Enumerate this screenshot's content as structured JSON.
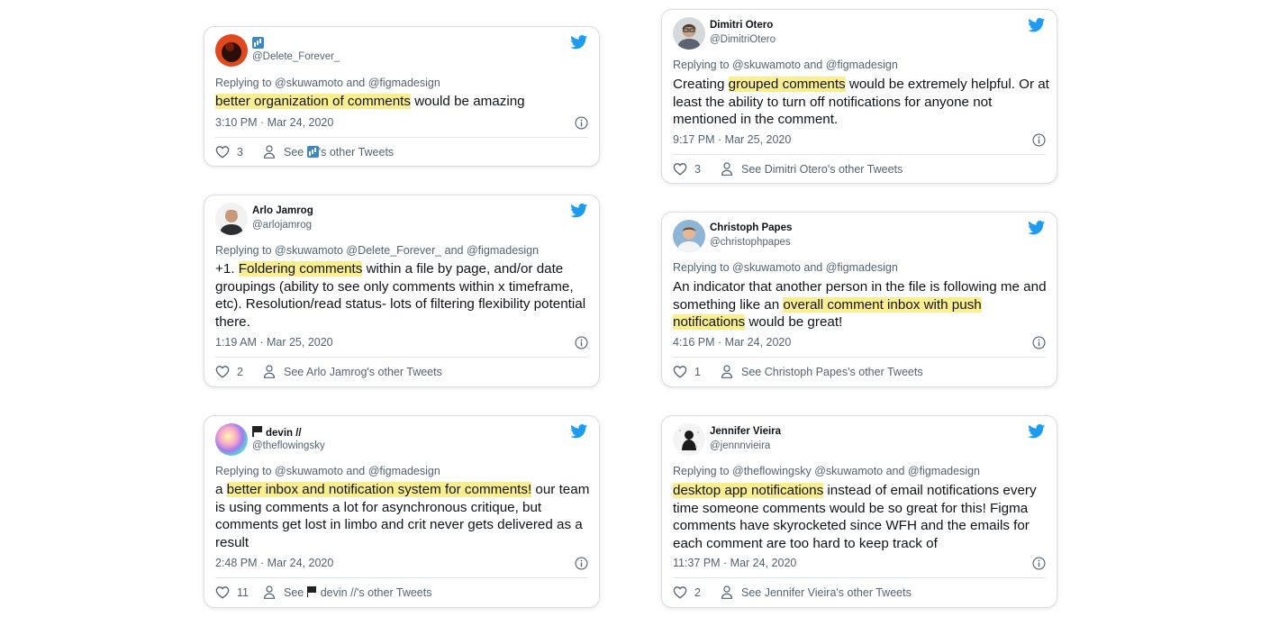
{
  "tweets": [
    {
      "name": "",
      "handle": "@Delete_Forever_",
      "replying": "Replying to @skuwamoto and @figmadesign",
      "body_hl1": "better organization of comments",
      "body_rest1": " would be amazing",
      "time": "3:10 PM · Mar 24, 2020",
      "likes": "3",
      "see_pre": "See ",
      "see_post": "'s other Tweets"
    },
    {
      "name": "Arlo Jamrog",
      "handle": "@arlojamrog",
      "replying": "Replying to @skuwamoto @Delete_Forever_ and @figmadesign",
      "body_pre": "+1. ",
      "body_hl1": "Foldering comments",
      "body_rest1": " within a file by page, and/or date groupings (ability to see only comments within x timeframe, etc). Resolution/read status- lots of filtering flexibility potential there.",
      "time": "1:19 AM · Mar 25, 2020",
      "likes": "2",
      "see": "See Arlo Jamrog's other Tweets"
    },
    {
      "name": "devin //",
      "handle": "@theflowingsky",
      "replying": "Replying to @skuwamoto and @figmadesign",
      "body_pre": "a ",
      "body_hl1": "better inbox and notification system for comments!",
      "body_rest1": " our team is using comments a lot for asynchronous critique, but comments get lost in limbo and crit never gets delivered as a result",
      "time": "2:48 PM · Mar 24, 2020",
      "likes": "11",
      "see_pre": "See ",
      "see_post": "devin //'s other Tweets"
    },
    {
      "name": "Dimitri Otero",
      "handle": "@DimitriOtero",
      "replying": "Replying to @skuwamoto and @figmadesign",
      "body_pre": "Creating ",
      "body_hl1": "grouped comments",
      "body_rest1": " would be extremely helpful. Or at least the ability to turn off notifications for anyone not mentioned in the comment.",
      "time": "9:17 PM · Mar 25, 2020",
      "likes": "3",
      "see": "See Dimitri Otero's other Tweets"
    },
    {
      "name": "Christoph Papes",
      "handle": "@christophpapes",
      "replying": "Replying to @skuwamoto and @figmadesign",
      "body_pre": "An indicator that another person in the file is following me and something like an ",
      "body_hl1": "overall comment inbox with push notifications",
      "body_rest1": " would be great!",
      "time": "4:16 PM · Mar 24, 2020",
      "likes": "1",
      "see": "See Christoph Papes's other Tweets"
    },
    {
      "name": "Jennifer Vieira",
      "handle": "@jennnvieira",
      "replying": "Replying to @theflowingsky @skuwamoto and @figmadesign",
      "body_hl1": "desktop app notifications",
      "body_rest1": " instead of email notifications every time someone comments would be so great for this! Figma comments have skyrocketed since WFH and the emails for each comment are too hard to keep track of",
      "time": "11:37 PM · Mar 24, 2020",
      "likes": "2",
      "see": "See Jennifer Vieira's other Tweets"
    }
  ],
  "icons": {
    "bird": "twitter-bird-icon",
    "heart": "heart-icon",
    "person": "person-icon",
    "info": "info-icon"
  },
  "colors": {
    "highlight": "#fbee8f",
    "twitter_blue": "#1d9bf0",
    "secondary_text": "#536471"
  }
}
